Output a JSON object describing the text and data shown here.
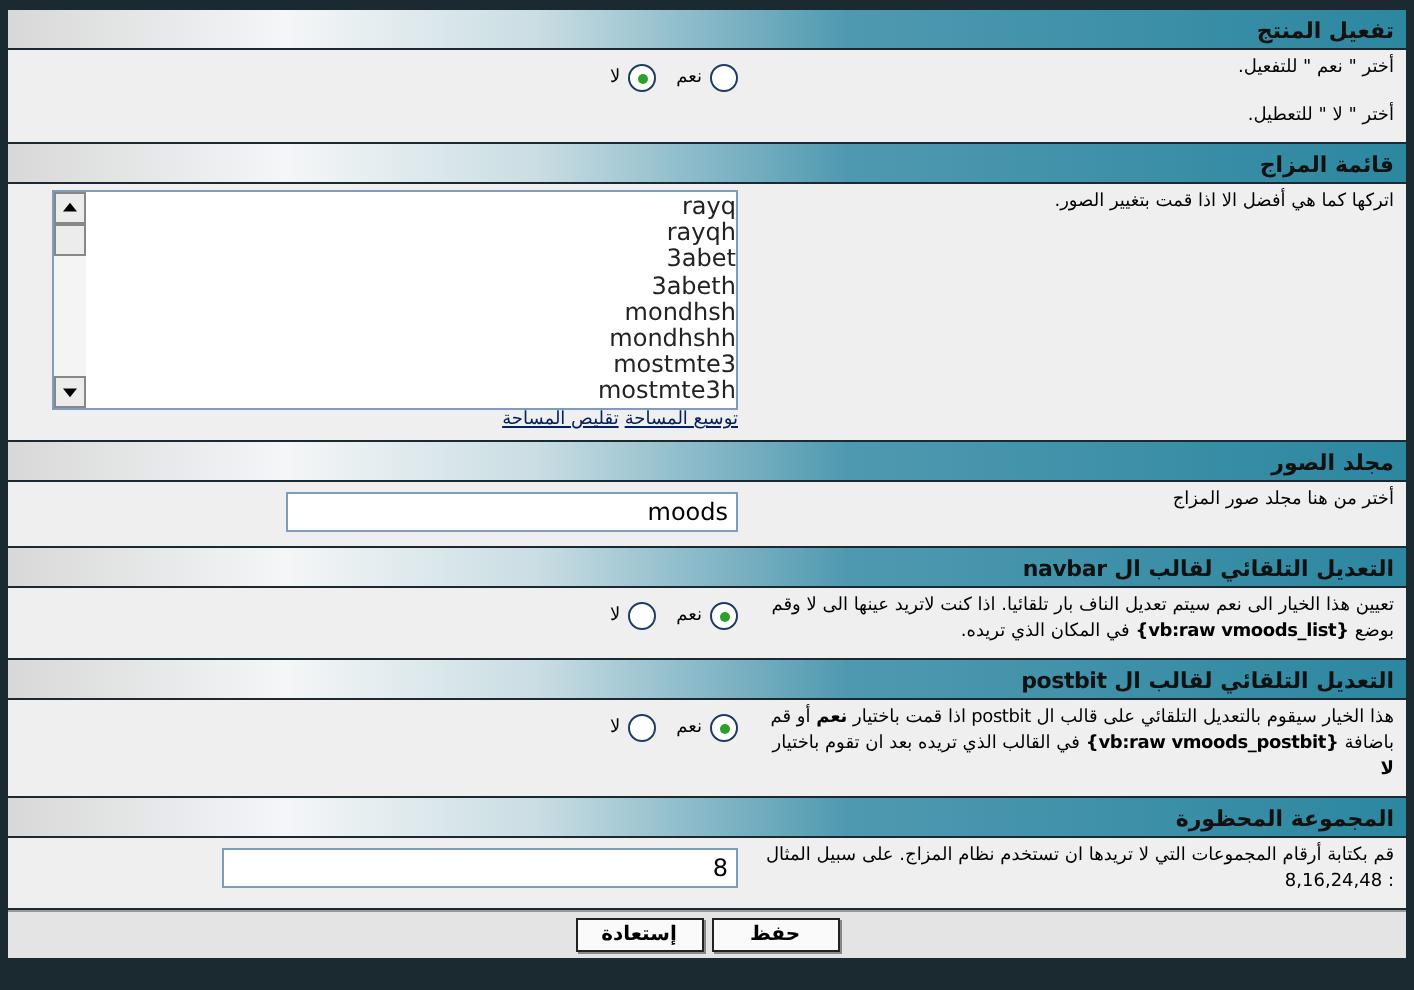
{
  "sections": [
    {
      "title": "تفعيل المنتج",
      "descriptions": [
        "أختر \" نعم \" للتفعيل.",
        "أختر \" لا \" للتعطيل."
      ],
      "control": {
        "kind": "radio",
        "options": [
          {
            "label": "نعم",
            "selected": false
          },
          {
            "label": "لا",
            "selected": true
          }
        ]
      }
    },
    {
      "title": "قائمة المزاج",
      "descriptions": [
        "اتركها كما هي أفضل الا اذا قمت بتغيير الصور."
      ],
      "control": {
        "kind": "listbox",
        "items": [
          "rayq",
          "rayqh",
          "3abet",
          "3abeth",
          "mondhsh",
          "mondhshh",
          "mostmte3",
          "mostmte3h"
        ],
        "links": [
          "توسيع المساحة",
          "تقليص المساحة"
        ]
      }
    },
    {
      "title": "مجلد الصور",
      "descriptions": [
        "أختر من هنا مجلد صور المزاج"
      ],
      "control": {
        "kind": "text",
        "value": "moods"
      }
    },
    {
      "title": "التعديل التلقائي لقالب ال navbar",
      "descriptions": [
        "تعيين هذا الخيار الى نعم سيتم تعديل الناف بار تلقائيا. اذا كنت لاتريد عينها الى لا وقم بوضع **{vb:raw vmoods_list}** في المكان الذي تريده."
      ],
      "control": {
        "kind": "radio",
        "options": [
          {
            "label": "نعم",
            "selected": true
          },
          {
            "label": "لا",
            "selected": false
          }
        ]
      }
    },
    {
      "title": "التعديل التلقائي لقالب ال postbit",
      "descriptions": [
        "هذا الخيار سيقوم بالتعديل التلقائي على قالب ال postbit اذا قمت باختيار **نعم** أو قم باضافة **{vb:raw vmoods_postbit}** في القالب الذي تريده بعد ان تقوم باختيار **لا**"
      ],
      "control": {
        "kind": "radio",
        "options": [
          {
            "label": "نعم",
            "selected": true
          },
          {
            "label": "لا",
            "selected": false
          }
        ]
      }
    },
    {
      "title": "المجموعة المحظورة",
      "descriptions": [
        "قم بكتابة أرقام المجموعات التي لا تريدها ان تستخدم نظام المزاج. على سبيل المثال : 8,16,24,48"
      ],
      "control": {
        "kind": "text",
        "value": "8"
      }
    }
  ],
  "buttons": [
    "حفظ",
    "إستعادة"
  ]
}
